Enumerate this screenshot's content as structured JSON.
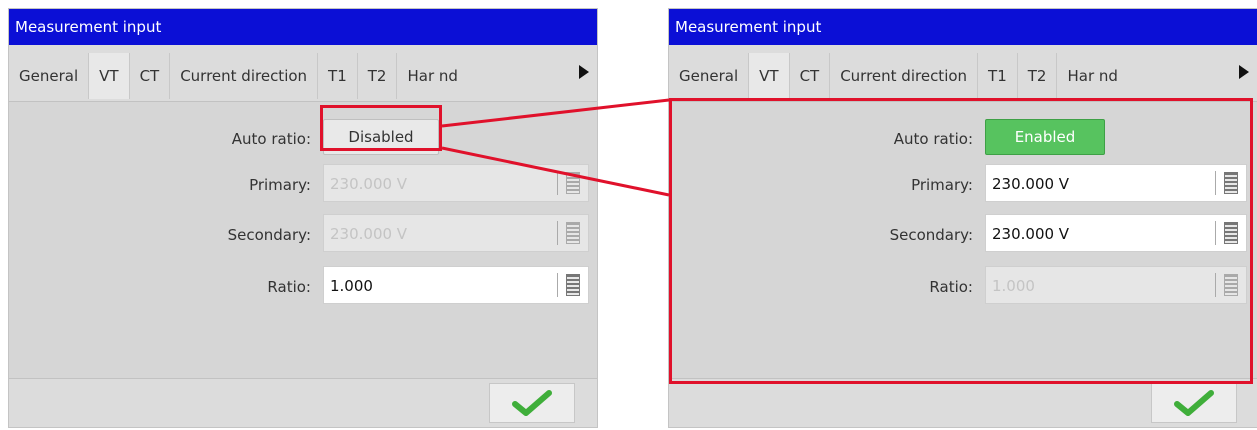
{
  "left_panel": {
    "title": "Measurement input",
    "tabs": [
      "General",
      "VT",
      "CT",
      "Current direction",
      "T1",
      "T2",
      "Har nd"
    ],
    "active_tab": "VT",
    "auto_ratio": {
      "label": "Auto ratio:",
      "button": "Disabled"
    },
    "primary": {
      "label": "Primary:",
      "value": "230.000 V",
      "enabled": false
    },
    "secondary": {
      "label": "Secondary:",
      "value": "230.000 V",
      "enabled": false
    },
    "ratio": {
      "label": "Ratio:",
      "value": "1.000",
      "enabled": true
    }
  },
  "right_panel": {
    "title": "Measurement input",
    "tabs": [
      "General",
      "VT",
      "CT",
      "Current direction",
      "T1",
      "T2",
      "Har nd"
    ],
    "active_tab": "VT",
    "auto_ratio": {
      "label": "Auto ratio:",
      "button": "Enabled"
    },
    "primary": {
      "label": "Primary:",
      "value": "230.000 V",
      "enabled": true
    },
    "secondary": {
      "label": "Secondary:",
      "value": "230.000 V",
      "enabled": true
    },
    "ratio": {
      "label": "Ratio:",
      "value": "1.000",
      "enabled": false
    }
  },
  "colors": {
    "title_bar": "#0b0fd6",
    "highlight": "#e0112b",
    "enabled_button": "#57c35f",
    "ok_check": "#3fae3a"
  },
  "icons": [
    "calculator-icon",
    "checkmark-icon",
    "scroll-right-icon"
  ]
}
